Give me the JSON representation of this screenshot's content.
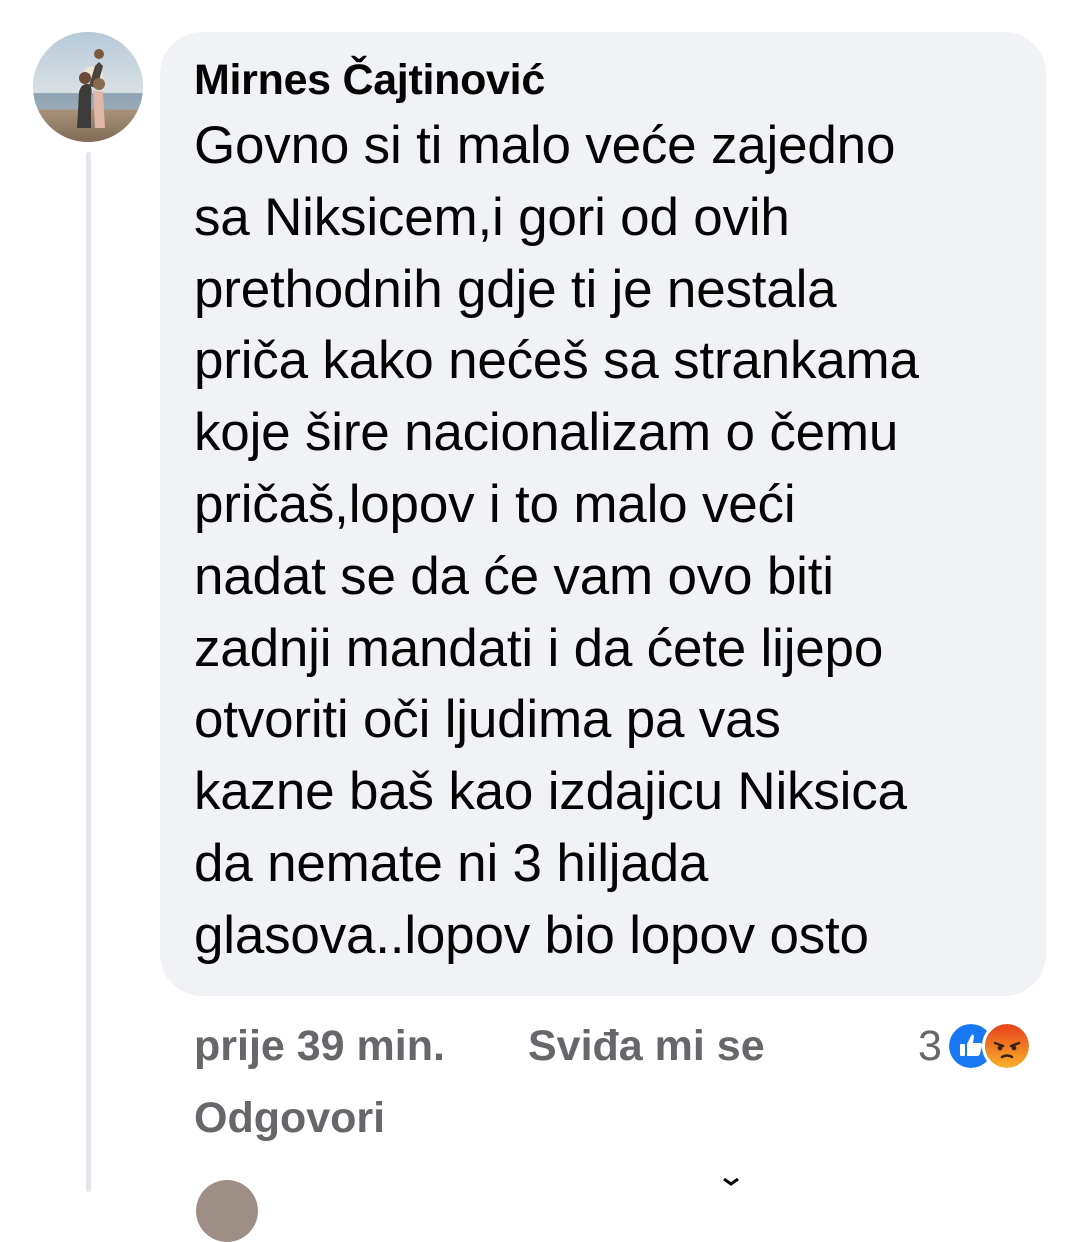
{
  "comment": {
    "author": "Mirnes Čajtinović",
    "text": "Govno si ti malo veće zajedno\nsa Niksicem,i gori od ovih\nprethodnih gdje ti je nestala\npriča kako nećeš sa strankama\nkoje šire nacionalizam o čemu\npričaš,lopov i to malo veći\nnadat se da će vam ovo biti\nzadnji mandati i da ćete lijepo\notvoriti oči ljudima pa vas\nkazne baš kao izdajicu Niksica\nda nemate ni 3 hiljada\nglasova..lopov bio lopov osto",
    "time": "prije 39 min.",
    "like_label": "Sviđa mi se",
    "reply_label": "Odgovori",
    "reaction_count": "3",
    "reactions": [
      "like-icon",
      "angry-icon"
    ]
  },
  "colors": {
    "bubble_bg": "#f0f2f5",
    "meta_text": "#65676b",
    "like_blue": "#1877f2",
    "angry_orange": "#f25c27"
  }
}
